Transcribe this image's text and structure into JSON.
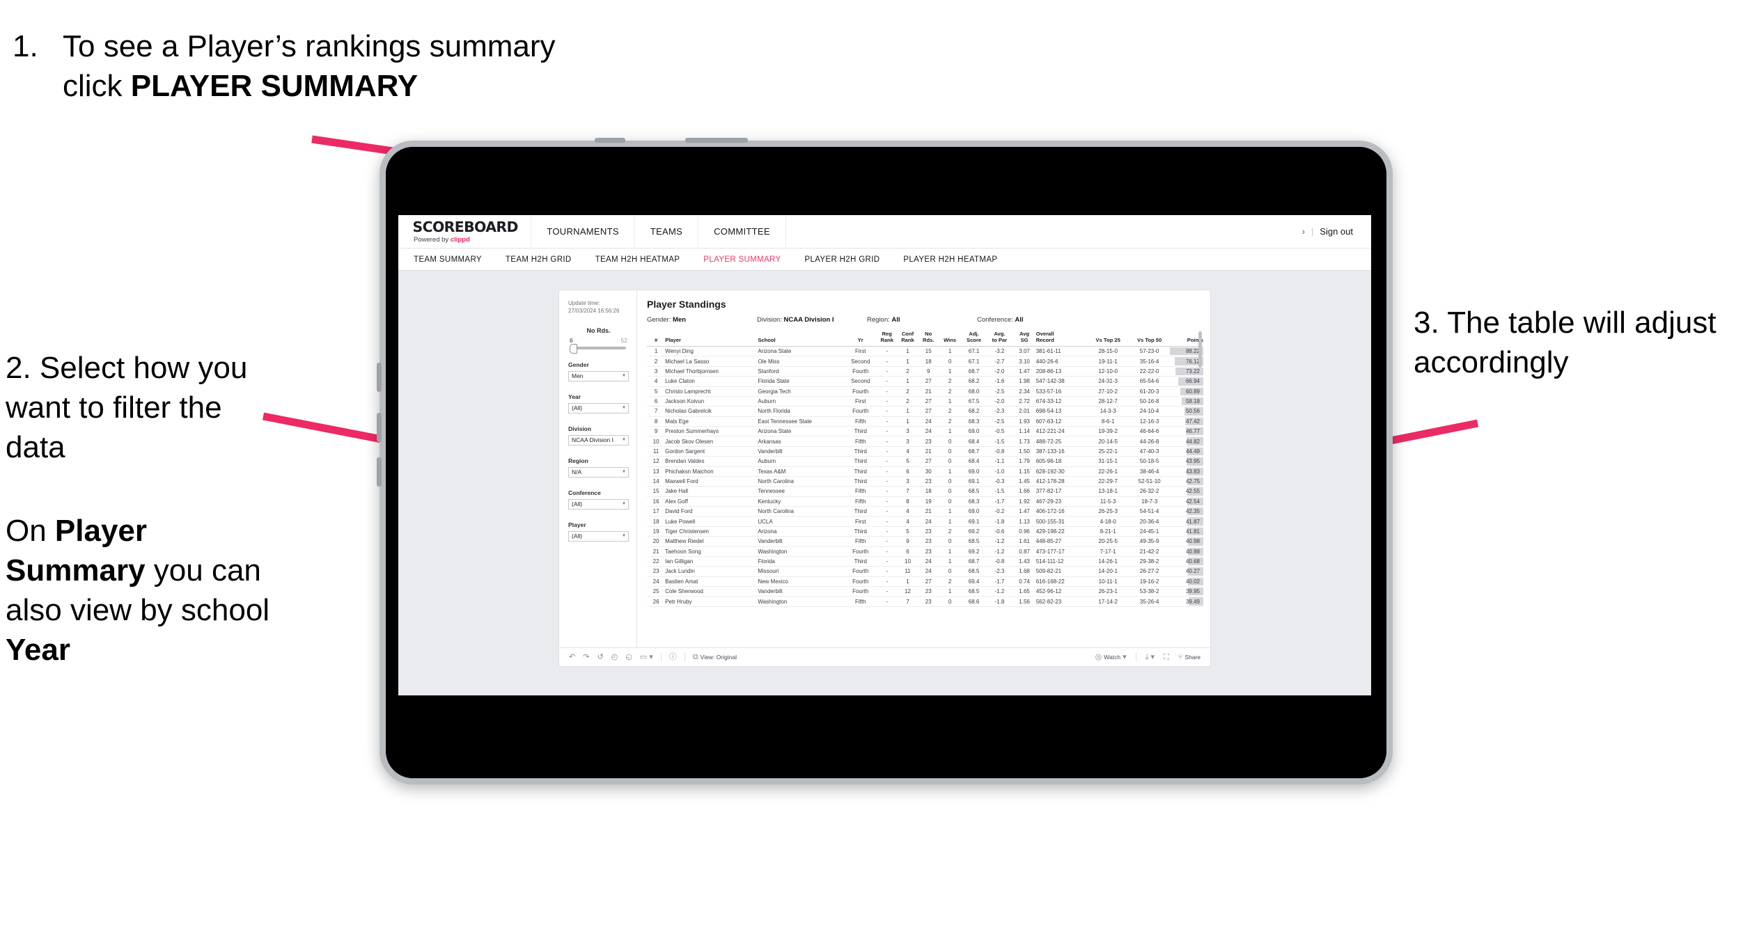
{
  "annotations": {
    "one": {
      "number": "1.",
      "text_before": "To see a Player’s rankings summary click ",
      "bold": "PLAYER SUMMARY"
    },
    "two": {
      "para1": "2. Select how you want to filter the data",
      "para2_a": "On ",
      "para2_b": "Player Summary",
      "para2_c": " you can also view by school ",
      "para2_d": "Year"
    },
    "three": {
      "text": "3. The table will adjust accordingly"
    }
  },
  "app": {
    "brand": {
      "name": "SCOREBOARD",
      "powered_prefix": "Powered by ",
      "powered_brand": "clippd"
    },
    "topnav": [
      "TOURNAMENTS",
      "TEAMS",
      "COMMITTEE"
    ],
    "header_right": {
      "chevron": "›",
      "separator": "|",
      "sign_out": "Sign out"
    },
    "subnav": [
      {
        "label": "TEAM SUMMARY",
        "active": false
      },
      {
        "label": "TEAM H2H GRID",
        "active": false
      },
      {
        "label": "TEAM H2H HEATMAP",
        "active": false
      },
      {
        "label": "PLAYER SUMMARY",
        "active": true
      },
      {
        "label": "PLAYER H2H GRID",
        "active": false
      },
      {
        "label": "PLAYER H2H HEATMAP",
        "active": false
      }
    ],
    "accent_color": "#ec3a68",
    "arrow_color": "#ec2a63"
  },
  "viz": {
    "update_label": "Update time:",
    "update_value": "27/03/2024 16:56:26",
    "title": "Player Standings",
    "meta": [
      {
        "label": "Gender:",
        "value": "Men"
      },
      {
        "label": "Division:",
        "value": "NCAA Division I"
      },
      {
        "label": "Region:",
        "value": "All"
      },
      {
        "label": "Conference:",
        "value": "All"
      }
    ],
    "filters": {
      "slider": {
        "label": "No Rds.",
        "min": "6",
        "max": "52",
        "position_pct": 8
      },
      "selects": [
        {
          "label": "Gender",
          "value": "Men"
        },
        {
          "label": "Year",
          "value": "(All)"
        },
        {
          "label": "Division",
          "value": "NCAA Division I"
        },
        {
          "label": "Region",
          "value": "N/A"
        },
        {
          "label": "Conference",
          "value": "(All)"
        },
        {
          "label": "Player",
          "value": "(All)"
        }
      ]
    },
    "toolbar": {
      "undo_icon": "↶",
      "redo_icon": "↷",
      "revert_icon": "↺",
      "refresh_icon": "◴",
      "pause_icon": "◵",
      "custom_icon": "▭",
      "caret": "▾",
      "help_icon": "ⓘ",
      "view_icon": "⧉",
      "view_label": "View: Original",
      "watch_icon": "◎",
      "watch_label": "Watch",
      "download_icon": "⤓",
      "fullscreen_icon": "⛶",
      "share_icon": "⑂",
      "share_label": "Share"
    }
  },
  "table": {
    "headers": [
      {
        "l1": "#",
        "l2": ""
      },
      {
        "l1": "Player",
        "l2": ""
      },
      {
        "l1": "School",
        "l2": ""
      },
      {
        "l1": "Yr",
        "l2": ""
      },
      {
        "l1": "Reg",
        "l2": "Rank"
      },
      {
        "l1": "Conf",
        "l2": "Rank"
      },
      {
        "l1": "No",
        "l2": "Rds."
      },
      {
        "l1": "Wins",
        "l2": ""
      },
      {
        "l1": "Adj.",
        "l2": "Score"
      },
      {
        "l1": "Avg.",
        "l2": "to Par"
      },
      {
        "l1": "Avg",
        "l2": "SG"
      },
      {
        "l1": "Overall",
        "l2": "Record"
      },
      {
        "l1": "Vs Top 25",
        "l2": ""
      },
      {
        "l1": "Vs Top 50",
        "l2": ""
      },
      {
        "l1": "Points",
        "l2": ""
      }
    ],
    "rows": [
      {
        "rank": "1",
        "player": "Wenyi Ding",
        "school": "Arizona State",
        "yr": "First",
        "reg": "-",
        "conf": "1",
        "rds": "15",
        "wins": "1",
        "adj": "67.1",
        "par": "-3.2",
        "sg": "3.07",
        "rec": "381-61-11",
        "t25": "28-15-0",
        "t50": "57-23-0",
        "pts": "88.22"
      },
      {
        "rank": "2",
        "player": "Michael La Sasso",
        "school": "Ole Miss",
        "yr": "Second",
        "reg": "-",
        "conf": "1",
        "rds": "18",
        "wins": "0",
        "adj": "67.1",
        "par": "-2.7",
        "sg": "3.10",
        "rec": "440-26-6",
        "t25": "19-11-1",
        "t50": "35-16-4",
        "pts": "76.12"
      },
      {
        "rank": "3",
        "player": "Michael Thorbjornsen",
        "school": "Stanford",
        "yr": "Fourth",
        "reg": "-",
        "conf": "2",
        "rds": "9",
        "wins": "1",
        "adj": "68.7",
        "par": "-2.0",
        "sg": "1.47",
        "rec": "208-86-13",
        "t25": "12-10-0",
        "t50": "22-22-0",
        "pts": "73.22"
      },
      {
        "rank": "4",
        "player": "Luke Claton",
        "school": "Florida State",
        "yr": "Second",
        "reg": "-",
        "conf": "1",
        "rds": "27",
        "wins": "2",
        "adj": "68.2",
        "par": "-1.6",
        "sg": "1.98",
        "rec": "547-142-38",
        "t25": "24-31-3",
        "t50": "65-54-6",
        "pts": "66.94"
      },
      {
        "rank": "5",
        "player": "Christo Lamprecht",
        "school": "Georgia Tech",
        "yr": "Fourth",
        "reg": "-",
        "conf": "2",
        "rds": "21",
        "wins": "2",
        "adj": "68.0",
        "par": "-2.5",
        "sg": "2.34",
        "rec": "533-57-16",
        "t25": "27-10-2",
        "t50": "61-20-3",
        "pts": "60.89"
      },
      {
        "rank": "6",
        "player": "Jackson Koivun",
        "school": "Auburn",
        "yr": "First",
        "reg": "-",
        "conf": "2",
        "rds": "27",
        "wins": "1",
        "adj": "67.5",
        "par": "-2.0",
        "sg": "2.72",
        "rec": "674-33-12",
        "t25": "28-12-7",
        "t50": "50-16-8",
        "pts": "58.18"
      },
      {
        "rank": "7",
        "player": "Nicholas Gabrelcik",
        "school": "North Florida",
        "yr": "Fourth",
        "reg": "-",
        "conf": "1",
        "rds": "27",
        "wins": "2",
        "adj": "68.2",
        "par": "-2.3",
        "sg": "2.01",
        "rec": "698-54-13",
        "t25": "14-3-3",
        "t50": "24-10-4",
        "pts": "50.56"
      },
      {
        "rank": "8",
        "player": "Mats Ege",
        "school": "East Tennessee State",
        "yr": "Fifth",
        "reg": "-",
        "conf": "1",
        "rds": "24",
        "wins": "2",
        "adj": "68.3",
        "par": "-2.5",
        "sg": "1.93",
        "rec": "607-63-12",
        "t25": "8-6-1",
        "t50": "12-16-3",
        "pts": "47.42"
      },
      {
        "rank": "9",
        "player": "Preston Summerhays",
        "school": "Arizona State",
        "yr": "Third",
        "reg": "-",
        "conf": "3",
        "rds": "24",
        "wins": "1",
        "adj": "69.0",
        "par": "-0.5",
        "sg": "1.14",
        "rec": "412-221-24",
        "t25": "19-39-2",
        "t50": "46-64-6",
        "pts": "46.77"
      },
      {
        "rank": "10",
        "player": "Jacob Skov Olesen",
        "school": "Arkansas",
        "yr": "Fifth",
        "reg": "-",
        "conf": "3",
        "rds": "23",
        "wins": "0",
        "adj": "68.4",
        "par": "-1.5",
        "sg": "1.73",
        "rec": "488-72-25",
        "t25": "20-14-5",
        "t50": "44-26-8",
        "pts": "44.82"
      },
      {
        "rank": "11",
        "player": "Gordon Sargent",
        "school": "Vanderbilt",
        "yr": "Third",
        "reg": "-",
        "conf": "4",
        "rds": "21",
        "wins": "0",
        "adj": "68.7",
        "par": "-0.8",
        "sg": "1.50",
        "rec": "387-133-16",
        "t25": "25-22-1",
        "t50": "47-40-3",
        "pts": "44.49"
      },
      {
        "rank": "12",
        "player": "Brendan Valdes",
        "school": "Auburn",
        "yr": "Third",
        "reg": "-",
        "conf": "5",
        "rds": "27",
        "wins": "0",
        "adj": "68.4",
        "par": "-1.1",
        "sg": "1.79",
        "rec": "605-96-18",
        "t25": "31-15-1",
        "t50": "50-18-5",
        "pts": "43.95"
      },
      {
        "rank": "13",
        "player": "Phichaksn Maichon",
        "school": "Texas A&M",
        "yr": "Third",
        "reg": "-",
        "conf": "6",
        "rds": "30",
        "wins": "1",
        "adj": "69.0",
        "par": "-1.0",
        "sg": "1.15",
        "rec": "628-192-30",
        "t25": "22-26-1",
        "t50": "38-46-4",
        "pts": "43.83"
      },
      {
        "rank": "14",
        "player": "Maxwell Ford",
        "school": "North Carolina",
        "yr": "Third",
        "reg": "-",
        "conf": "3",
        "rds": "23",
        "wins": "0",
        "adj": "69.1",
        "par": "-0.3",
        "sg": "1.45",
        "rec": "412-178-28",
        "t25": "22-29-7",
        "t50": "52-51-10",
        "pts": "42.75"
      },
      {
        "rank": "15",
        "player": "Jake Hall",
        "school": "Tennessee",
        "yr": "Fifth",
        "reg": "-",
        "conf": "7",
        "rds": "18",
        "wins": "0",
        "adj": "68.5",
        "par": "-1.5",
        "sg": "1.66",
        "rec": "377-82-17",
        "t25": "13-18-1",
        "t50": "26-32-2",
        "pts": "42.55"
      },
      {
        "rank": "16",
        "player": "Alex Goff",
        "school": "Kentucky",
        "yr": "Fifth",
        "reg": "-",
        "conf": "8",
        "rds": "19",
        "wins": "0",
        "adj": "68.3",
        "par": "-1.7",
        "sg": "1.92",
        "rec": "467-29-23",
        "t25": "11-5-3",
        "t50": "18-7-3",
        "pts": "42.54"
      },
      {
        "rank": "17",
        "player": "David Ford",
        "school": "North Carolina",
        "yr": "Third",
        "reg": "-",
        "conf": "4",
        "rds": "21",
        "wins": "1",
        "adj": "69.0",
        "par": "-0.2",
        "sg": "1.47",
        "rec": "406-172-16",
        "t25": "26-25-3",
        "t50": "54-51-4",
        "pts": "42.35"
      },
      {
        "rank": "18",
        "player": "Luke Powell",
        "school": "UCLA",
        "yr": "First",
        "reg": "-",
        "conf": "4",
        "rds": "24",
        "wins": "1",
        "adj": "69.1",
        "par": "-1.8",
        "sg": "1.13",
        "rec": "500-155-31",
        "t25": "4-18-0",
        "t50": "20-36-4",
        "pts": "41.87"
      },
      {
        "rank": "19",
        "player": "Tiger Christensen",
        "school": "Arizona",
        "yr": "Third",
        "reg": "-",
        "conf": "5",
        "rds": "23",
        "wins": "2",
        "adj": "69.2",
        "par": "-0.6",
        "sg": "0.96",
        "rec": "429-198-22",
        "t25": "8-21-1",
        "t50": "24-45-1",
        "pts": "41.81"
      },
      {
        "rank": "20",
        "player": "Matthew Riedel",
        "school": "Vanderbilt",
        "yr": "Fifth",
        "reg": "-",
        "conf": "9",
        "rds": "23",
        "wins": "0",
        "adj": "68.5",
        "par": "-1.2",
        "sg": "1.61",
        "rec": "448-85-27",
        "t25": "20-25-5",
        "t50": "49-35-9",
        "pts": "40.98"
      },
      {
        "rank": "21",
        "player": "Taehoon Song",
        "school": "Washington",
        "yr": "Fourth",
        "reg": "-",
        "conf": "6",
        "rds": "23",
        "wins": "1",
        "adj": "69.2",
        "par": "-1.2",
        "sg": "0.87",
        "rec": "473-177-17",
        "t25": "7-17-1",
        "t50": "21-42-2",
        "pts": "40.88"
      },
      {
        "rank": "22",
        "player": "Ian Gilligan",
        "school": "Florida",
        "yr": "Third",
        "reg": "-",
        "conf": "10",
        "rds": "24",
        "wins": "1",
        "adj": "68.7",
        "par": "-0.8",
        "sg": "1.43",
        "rec": "514-111-12",
        "t25": "14-26-1",
        "t50": "29-38-2",
        "pts": "40.68"
      },
      {
        "rank": "23",
        "player": "Jack Lundin",
        "school": "Missouri",
        "yr": "Fourth",
        "reg": "-",
        "conf": "11",
        "rds": "24",
        "wins": "0",
        "adj": "68.5",
        "par": "-2.3",
        "sg": "1.68",
        "rec": "509-82-21",
        "t25": "14-20-1",
        "t50": "26-27-2",
        "pts": "40.27"
      },
      {
        "rank": "24",
        "player": "Bastien Amat",
        "school": "New Mexico",
        "yr": "Fourth",
        "reg": "-",
        "conf": "1",
        "rds": "27",
        "wins": "2",
        "adj": "69.4",
        "par": "-1.7",
        "sg": "0.74",
        "rec": "616-168-22",
        "t25": "10-11-1",
        "t50": "19-16-2",
        "pts": "40.02"
      },
      {
        "rank": "25",
        "player": "Cole Sherwood",
        "school": "Vanderbilt",
        "yr": "Fourth",
        "reg": "-",
        "conf": "12",
        "rds": "23",
        "wins": "1",
        "adj": "68.5",
        "par": "-1.2",
        "sg": "1.65",
        "rec": "452-96-12",
        "t25": "26-23-1",
        "t50": "53-38-2",
        "pts": "39.95"
      },
      {
        "rank": "26",
        "player": "Petr Hruby",
        "school": "Washington",
        "yr": "Fifth",
        "reg": "-",
        "conf": "7",
        "rds": "23",
        "wins": "0",
        "adj": "68.6",
        "par": "-1.8",
        "sg": "1.56",
        "rec": "562-82-23",
        "t25": "17-14-2",
        "t50": "35-26-4",
        "pts": "39.49"
      }
    ]
  }
}
